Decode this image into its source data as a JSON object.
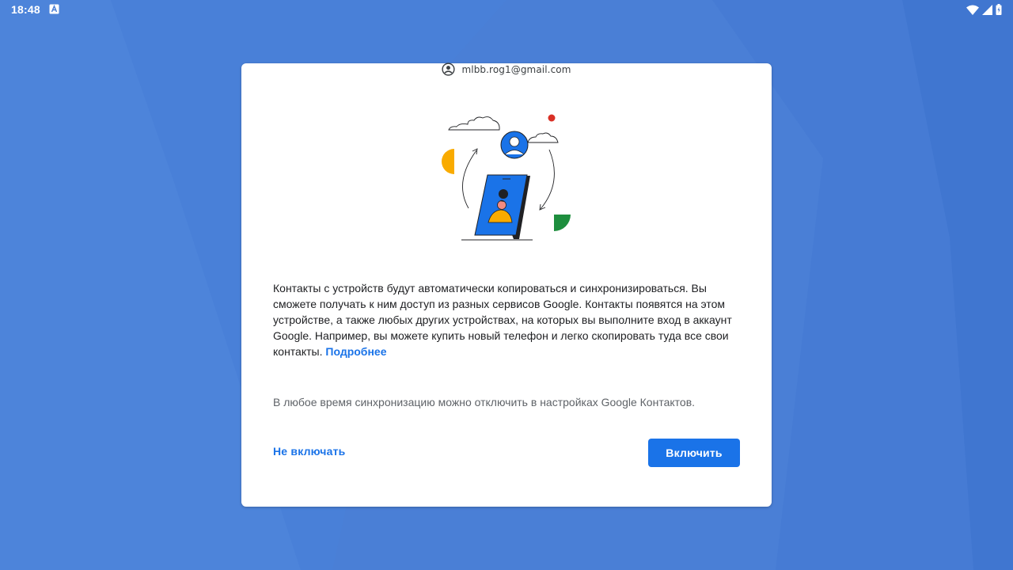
{
  "status_bar": {
    "time": "18:48",
    "notification_icon": "app-notification-icon",
    "icons": [
      "wifi-icon",
      "cellular-signal-icon",
      "battery-icon"
    ]
  },
  "dialog": {
    "account_email": "mlbb.rog1@gmail.com",
    "account_icon": "account-circle-icon",
    "body_text": "Контакты с устройств будут автоматически копироваться и синхронизироваться. Вы сможете получать к ним доступ из разных сервисов Google. Контакты появятся на этом устройстве, а также любых других устройствах, на которых вы выполните вход в аккаунт Google. Например, вы можете купить новый телефон и легко скопировать туда все свои контакты.",
    "learn_more_label": "Подробнее",
    "hint_text": "В любое время синхронизацию можно отключить в настройках Google Контактов.",
    "decline_label": "Не включать",
    "accept_label": "Включить"
  },
  "colors": {
    "wallpaper": "#4a7fd6",
    "accent": "#1a73e8",
    "text_primary": "#202124",
    "text_secondary": "#5f6368",
    "illustration_yellow": "#f9ab00",
    "illustration_green": "#1e8e3e",
    "illustration_red": "#d93025",
    "illustration_blue": "#1a73e8"
  }
}
